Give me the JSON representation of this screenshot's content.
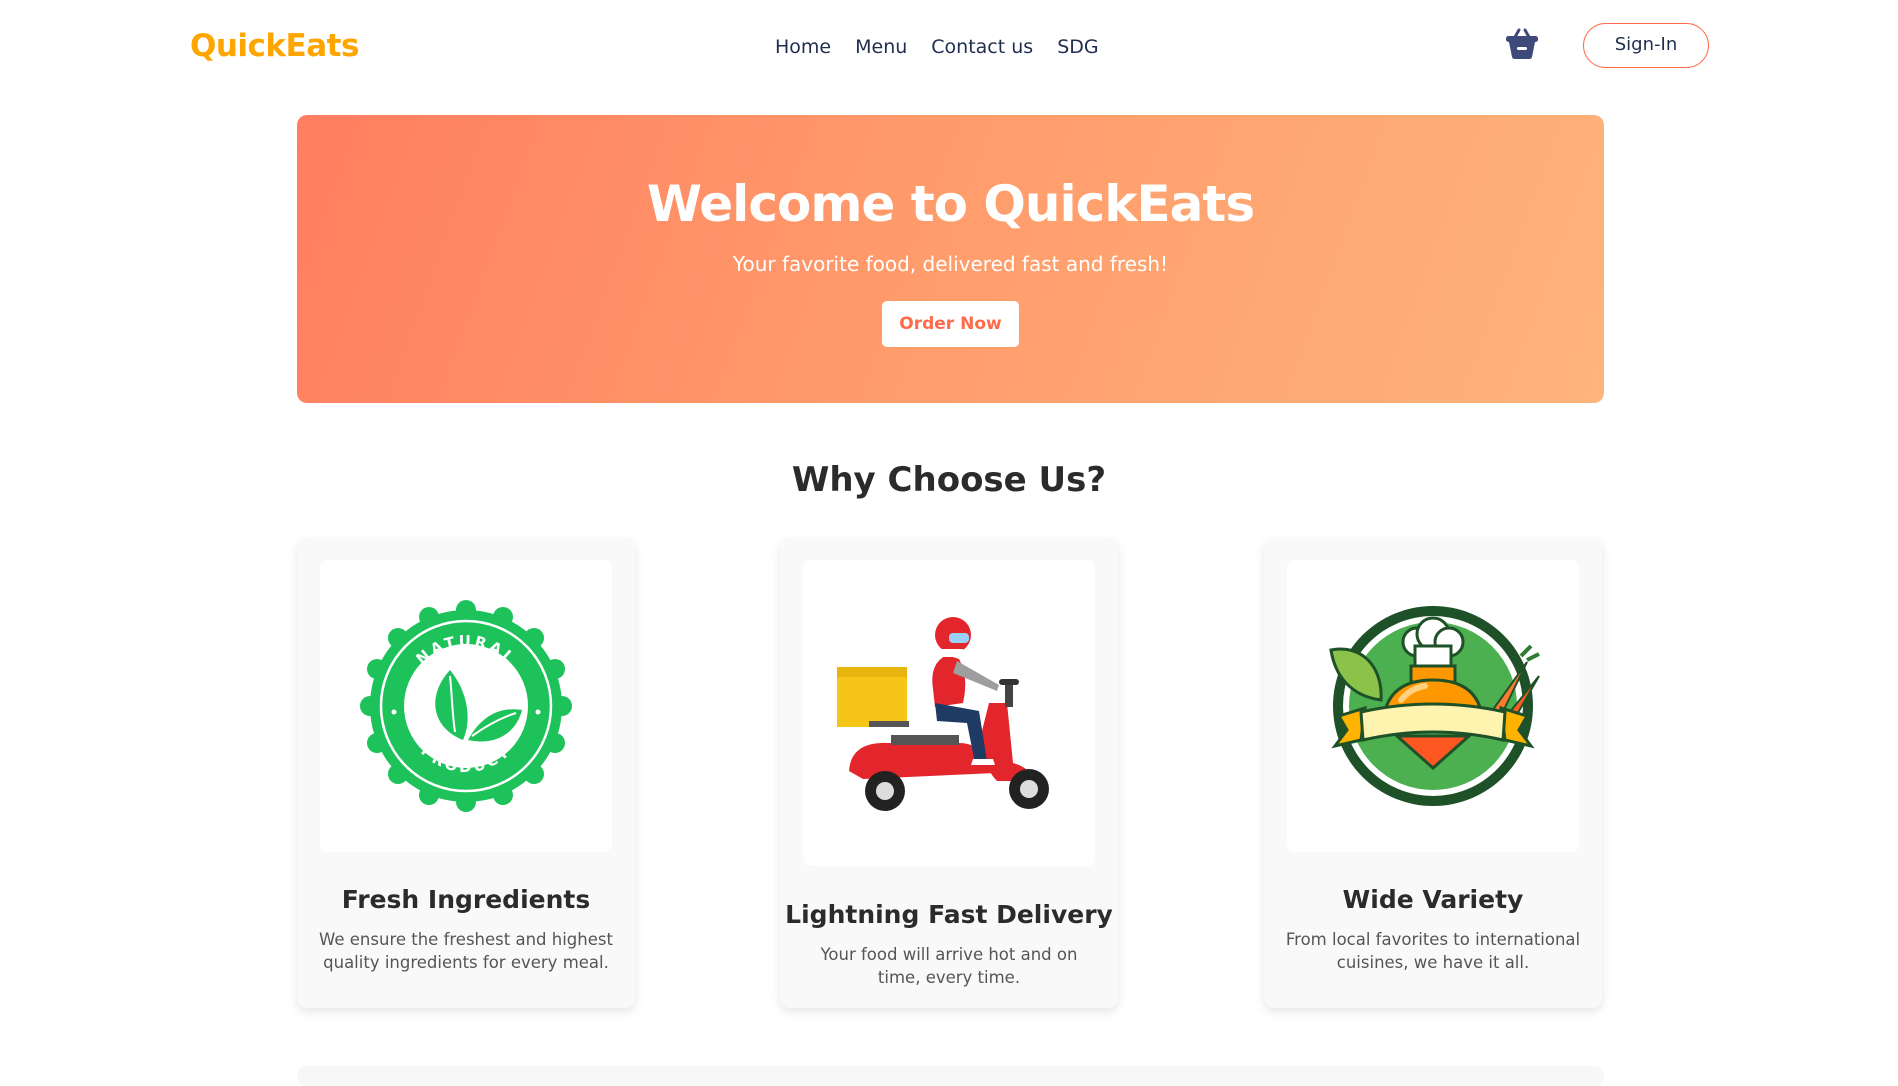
{
  "brand": {
    "name": "QuickEats",
    "color": "#ffa500"
  },
  "nav": {
    "items": [
      "Home",
      "Menu",
      "Contact us",
      "SDG"
    ]
  },
  "header": {
    "cart_icon": "shopping-basket-icon",
    "signin_label": "Sign-In"
  },
  "hero": {
    "title": "Welcome to QuickEats",
    "subtitle": "Your favorite food, delivered fast and fresh!",
    "cta_label": "Order Now",
    "gradient_start": "#ff7e5f",
    "gradient_end": "#feb47b"
  },
  "why": {
    "title": "Why Choose Us?",
    "cards": [
      {
        "image": "natural-product-badge-icon",
        "badge_top": "NATURAL",
        "badge_bottom": "PRODUCT",
        "title": "Fresh Ingredients",
        "description": "We ensure the freshest and highest quality ingredients for every meal."
      },
      {
        "image": "delivery-scooter-icon",
        "title": "Lightning Fast Delivery",
        "description": "Your food will arrive hot and on time, every time."
      },
      {
        "image": "food-variety-emblem-icon",
        "title": "Wide Variety",
        "description": "From local favorites to international cuisines, we have it all."
      }
    ]
  },
  "colors": {
    "accent": "#ff6b4a",
    "nav_text": "#1f2d4e",
    "card_bg": "#f9f9f9"
  }
}
